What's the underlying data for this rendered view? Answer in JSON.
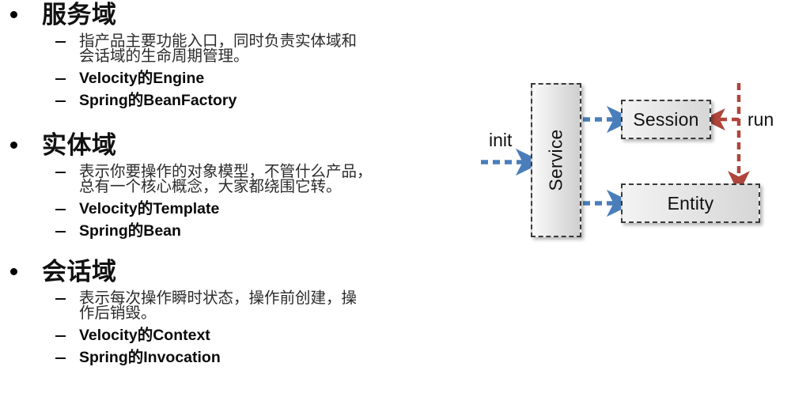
{
  "slide": {
    "background": "#ffffff",
    "accent_blue": "#4a7ebb",
    "accent_red": "#b0453c"
  },
  "outline": {
    "sections": [
      {
        "heading": "服务域",
        "description_line1": "指产品主要功能入口，同时负责实体域和",
        "description_line2": "会话域的生命周期管理。",
        "items": [
          "Velocity的Engine",
          "Spring的BeanFactory"
        ]
      },
      {
        "heading": "实体域",
        "description_line1": "表示你要操作的对象模型，不管什么产品，",
        "description_line2": "总有一个核心概念，大家都绕围它转。",
        "items": [
          "Velocity的Template",
          "Spring的Bean"
        ]
      },
      {
        "heading": "会话域",
        "description_line1": "表示每次操作瞬时状态，操作前创建，操",
        "description_line2": "作后销毁。",
        "items": [
          "Velocity的Context",
          "Spring的Invocation"
        ]
      }
    ]
  },
  "diagram": {
    "nodes": {
      "service": "Service",
      "session": "Session",
      "entity": "Entity"
    },
    "labels": {
      "init": "init",
      "run": "run"
    },
    "edges": [
      {
        "name": "init-to-service",
        "from": "init",
        "to": "service",
        "color": "#4a7ebb",
        "style": "dashed"
      },
      {
        "name": "service-to-session",
        "from": "service",
        "to": "session",
        "color": "#4a7ebb",
        "style": "dashed"
      },
      {
        "name": "service-to-entity",
        "from": "service",
        "to": "entity",
        "color": "#4a7ebb",
        "style": "dashed"
      },
      {
        "name": "run-to-session",
        "from": "run",
        "to": "session",
        "color": "#b0453c",
        "style": "dashed"
      },
      {
        "name": "run-to-entity",
        "from": "run",
        "to": "entity",
        "color": "#b0453c",
        "style": "dashed"
      }
    ]
  }
}
